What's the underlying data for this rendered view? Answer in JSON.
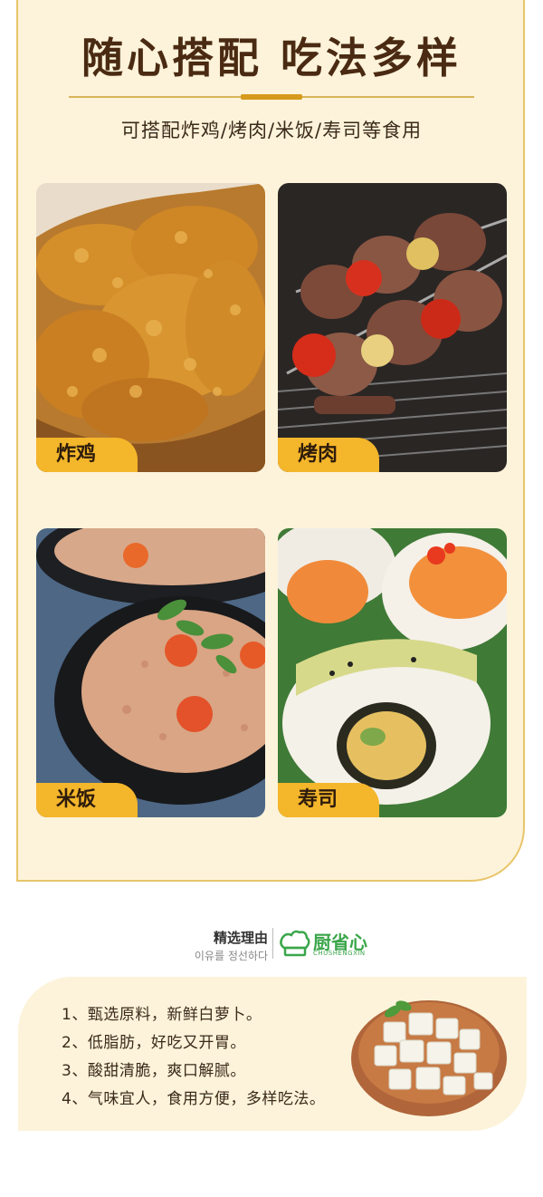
{
  "header": {
    "title": "随心搭配  吃法多样",
    "subtitle": "可搭配炸鸡/烤肉/米饭/寿司等食用"
  },
  "foods": [
    {
      "label": "炸鸡",
      "icon": "fried-chicken-photo"
    },
    {
      "label": "烤肉",
      "icon": "bbq-skewers-photo"
    },
    {
      "label": "米饭",
      "icon": "fried-rice-photo"
    },
    {
      "label": "寿司",
      "icon": "sushi-rolls-photo"
    }
  ],
  "brand": {
    "label": "精选理由",
    "sub": "이유를 정선하다",
    "name": "厨省心",
    "en": "CHUSHENGXIN",
    "color": "#3aa64a"
  },
  "reasons": [
    "1、甄选原料，新鲜白萝卜。",
    "2、低脂肪，好吃又开胃。",
    "3、酸甜清脆，爽口解腻。",
    "4、气味宜人，食用方便，多样吃法。"
  ],
  "colors": {
    "panel": "#fdf3da",
    "accent": "#f4b62a",
    "title": "#4a2a12"
  }
}
